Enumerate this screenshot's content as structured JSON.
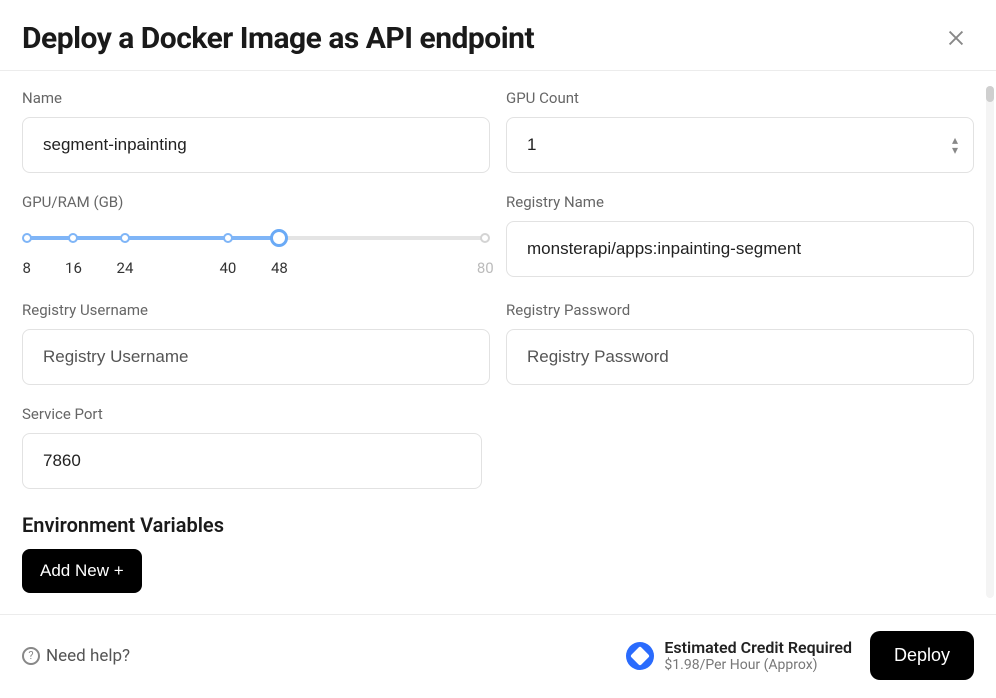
{
  "header": {
    "title": "Deploy a Docker Image as API endpoint"
  },
  "fields": {
    "name": {
      "label": "Name",
      "value": "segment-inpainting"
    },
    "gpu_count": {
      "label": "GPU Count",
      "value": "1"
    },
    "gpu_ram": {
      "label": "GPU/RAM (GB)",
      "ticks": [
        "8",
        "16",
        "24",
        "40",
        "48",
        "80"
      ],
      "value": "48"
    },
    "registry_name": {
      "label": "Registry Name",
      "value": "monsterapi/apps:inpainting-segment"
    },
    "registry_username": {
      "label": "Registry Username",
      "placeholder": "Registry Username",
      "value": ""
    },
    "registry_password": {
      "label": "Registry Password",
      "placeholder": "Registry Password",
      "value": ""
    },
    "service_port": {
      "label": "Service Port",
      "value": "7860"
    }
  },
  "env": {
    "section_title": "Environment Variables",
    "add_new_label": "Add New +"
  },
  "footer": {
    "help_label": "Need help?",
    "estimate_title": "Estimated Credit Required",
    "estimate_sub": "$1.98/Per Hour (Approx)",
    "deploy_label": "Deploy"
  }
}
